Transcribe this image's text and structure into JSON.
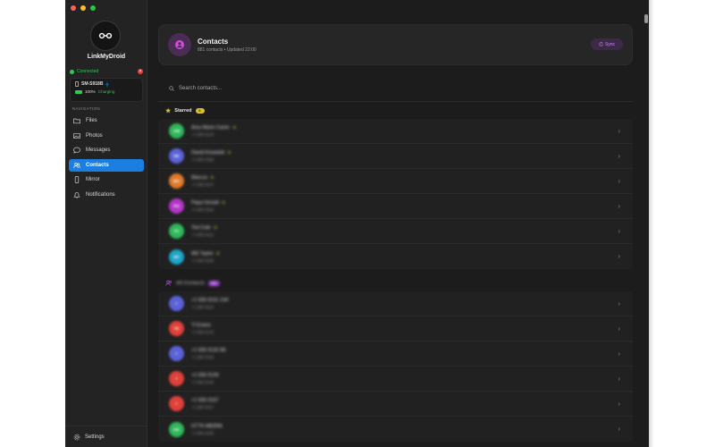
{
  "app": {
    "name": "LinkMyDroid"
  },
  "connection": {
    "status": "Connected"
  },
  "device": {
    "model": "SM-S918B",
    "battery": "100%",
    "battery_label": "Charging"
  },
  "navigation": {
    "heading": "NAVIGATION",
    "items": [
      {
        "label": "Files",
        "icon": "folder-icon",
        "active": false
      },
      {
        "label": "Photos",
        "icon": "photos-icon",
        "active": false
      },
      {
        "label": "Messages",
        "icon": "message-icon",
        "active": false
      },
      {
        "label": "Contacts",
        "icon": "contacts-icon",
        "active": true
      },
      {
        "label": "Mirror",
        "icon": "phone-icon",
        "active": false
      },
      {
        "label": "Notifications",
        "icon": "bell-icon",
        "active": false
      }
    ]
  },
  "settings": {
    "label": "Settings"
  },
  "header": {
    "title": "Contacts",
    "subtitle": "881 contacts • Updated 22:00",
    "sync_label": "Sync"
  },
  "search": {
    "placeholder": "Search contacts..."
  },
  "starred": {
    "label": "Starred",
    "count": "6",
    "contacts": [
      {
        "initials": "AM",
        "name": "Amy Marie Carter",
        "number": "+1 555 0143",
        "color": "#2fb85a"
      },
      {
        "initials": "DK",
        "name": "David Kowalski",
        "number": "+1 555 0198",
        "color": "#5a62d8"
      },
      {
        "initials": "MA",
        "name": "Marcus",
        "number": "+1 555 0127",
        "color": "#e07a2a"
      },
      {
        "initials": "PG",
        "name": "Papa Gerald",
        "number": "+1 555 0164",
        "color": "#b436c9"
      },
      {
        "initials": "TC",
        "name": "Ted Cole",
        "number": "+1 555 0112",
        "color": "#2fb85a"
      },
      {
        "initials": "MT",
        "name": "MD Taylor",
        "number": "+1 555 0185",
        "color": "#1ea4c8"
      }
    ]
  },
  "all": {
    "label": "All Contacts",
    "count": "881",
    "contacts": [
      {
        "initials": "+",
        "name": "+1 555 0101 234",
        "number": "+1 555 0101",
        "color": "#5a62d8"
      },
      {
        "initials": "TE",
        "name": "TI Evans",
        "number": "+1 555 0176",
        "color": "#e0413a"
      },
      {
        "initials": "+",
        "name": "+1 555 0132 88",
        "number": "+1 555 0132",
        "color": "#5a62d8"
      },
      {
        "initials": "+",
        "name": "+1 555 0149",
        "number": "+1 555 0149",
        "color": "#e0413a"
      },
      {
        "initials": "+",
        "name": "+1 555 0157",
        "number": "+1 555 0157",
        "color": "#e0413a"
      },
      {
        "initials": "GK",
        "name": "GTTK ABDRA",
        "number": "+1 555 0190",
        "color": "#2fb85a"
      }
    ]
  }
}
